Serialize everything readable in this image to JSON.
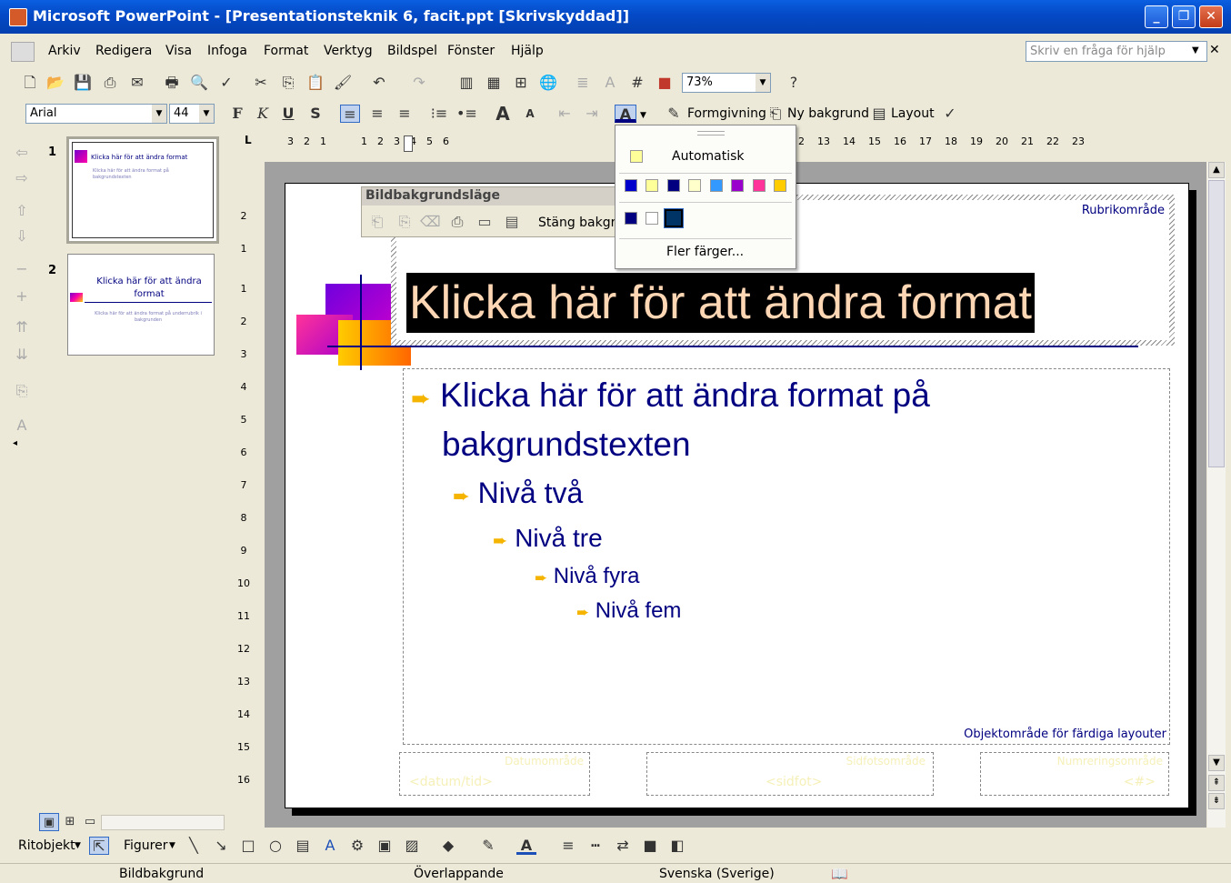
{
  "window": {
    "title": "Microsoft PowerPoint - [Presentationsteknik 6, facit.ppt [Skrivskyddad]]",
    "btn_minimize": "_",
    "btn_restore": "❐",
    "btn_close": "✕"
  },
  "menu": {
    "items": [
      "Arkiv",
      "Redigera",
      "Visa",
      "Infoga",
      "Format",
      "Verktyg",
      "Bildspel",
      "Fönster",
      "Hjälp"
    ],
    "help_placeholder": "Skriv en fråga för hjälp",
    "close_glyph": "✕"
  },
  "toolbar": {
    "zoom": "73%"
  },
  "formatting": {
    "font": "Arial",
    "size": "44",
    "bold": "F",
    "italic": "K",
    "underline": "U",
    "shadow": "S",
    "design_label": "Formgivning",
    "new_bg_label": "Ny bakgrund",
    "layout_label": "Layout"
  },
  "color_popup": {
    "auto_label": "Automatisk",
    "more_label": "Fler färger...",
    "scheme_colors": [
      "#0000cc",
      "#ffff99",
      "#000080",
      "#ffffcc",
      "#3399ff",
      "#9900cc",
      "#ff3399",
      "#ffcc00"
    ],
    "recent_colors": [
      "#000080",
      "#ffffff",
      "#003366"
    ],
    "auto_color": "#ffff99"
  },
  "bg_toolbar": {
    "title": "Bildbakgrundsläge",
    "close_label": "Stäng bakgru"
  },
  "ruler": {
    "h_labels": [
      "3",
      "2",
      "1",
      "1",
      "2",
      "3",
      "4",
      "5",
      "6",
      "2",
      "13",
      "14",
      "15",
      "16",
      "17",
      "18",
      "19",
      "20",
      "21",
      "22",
      "23"
    ],
    "v_labels": [
      "2",
      "1",
      "1",
      "2",
      "3",
      "4",
      "5",
      "6",
      "7",
      "8",
      "9",
      "10",
      "11",
      "12",
      "13",
      "14",
      "15",
      "16"
    ]
  },
  "thumbnails": [
    {
      "number": "1",
      "title": "Klicka här för att ändra format",
      "body": "Klicka här för att ändra format på bakgrundstexten"
    },
    {
      "number": "2",
      "title": "Klicka här för att ändra format",
      "body": "Klicka här för att ändra format på underrubrik i bakgrunden"
    }
  ],
  "slide": {
    "title_area_label": "Rubrikområde",
    "title_text": "Klicka här för att ändra format",
    "body_level1": "Klicka här för att ändra format på bakgrundstexten",
    "body_level1_line1": "Klicka här för att ändra format på",
    "body_level1_line2": "bakgrundstexten",
    "level2": "Nivå två",
    "level3": "Nivå tre",
    "level4": "Nivå fyra",
    "level5": "Nivå fem",
    "object_area_label": "Objektområde för färdiga layouter",
    "date_area_label": "Datumområde",
    "date_placeholder": "<datum/tid>",
    "footer_area_label": "Sidfotsområde",
    "footer_placeholder": "<sidfot>",
    "number_area_label": "Numreringsområde",
    "number_placeholder": "<#>",
    "bullet_glyph": "➨"
  },
  "drawing": {
    "draw_label": "Ritobjekt",
    "shapes_label": "Figurer"
  },
  "status": {
    "slide": "Bildbakgrund",
    "design": "Överlappande",
    "language": "Svenska (Sverige)"
  }
}
